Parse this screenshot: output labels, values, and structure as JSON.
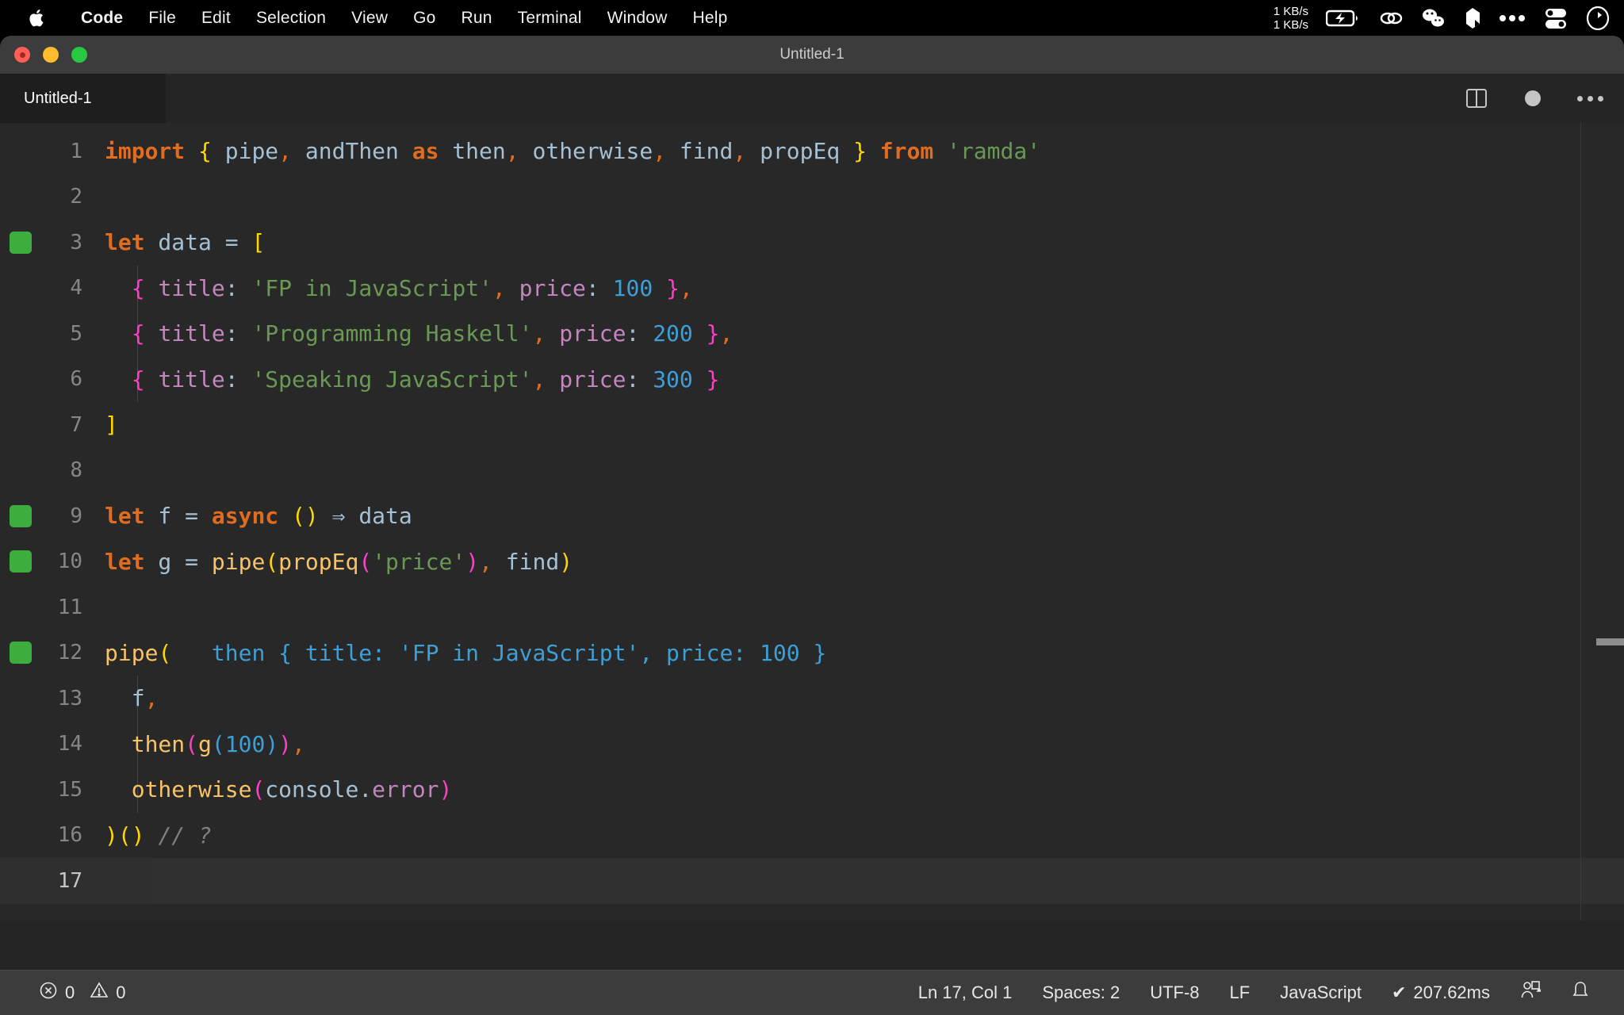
{
  "menubar": {
    "apple_icon": "apple-logo-icon",
    "items": [
      {
        "label": "Code",
        "bold": true
      },
      {
        "label": "File",
        "bold": false
      },
      {
        "label": "Edit",
        "bold": false
      },
      {
        "label": "Selection",
        "bold": false
      },
      {
        "label": "View",
        "bold": false
      },
      {
        "label": "Go",
        "bold": false
      },
      {
        "label": "Run",
        "bold": false
      },
      {
        "label": "Terminal",
        "bold": false
      },
      {
        "label": "Window",
        "bold": false
      },
      {
        "label": "Help",
        "bold": false
      }
    ],
    "network": {
      "up": "1 KB/s",
      "down": "1 KB/s"
    },
    "status_icons": [
      "battery-charging-icon",
      "link-chain-icon",
      "wechat-icon",
      "shape-icon",
      "more-dots-icon",
      "control-center-icon",
      "time-machine-icon"
    ]
  },
  "window": {
    "title": "Untitled-1",
    "traffic_lights": [
      "close-button",
      "minimize-button",
      "maximize-button"
    ]
  },
  "tabs": [
    {
      "label": "Untitled-1",
      "active": true
    }
  ],
  "editor_actions": {
    "split_editor": "split-editor-icon",
    "unsaved_indicator": "unsaved-dot-icon",
    "more_actions": "more-actions-icon"
  },
  "editor": {
    "language": "JavaScript",
    "lines": [
      {
        "n": "1",
        "git": false,
        "indent": false,
        "active": false,
        "tokens": [
          {
            "t": "import",
            "c": "t-kw"
          },
          {
            "t": " ",
            "c": "t-punct"
          },
          {
            "t": "{",
            "c": "b-yellow"
          },
          {
            "t": " pipe",
            "c": "t-var"
          },
          {
            "t": ",",
            "c": "t-comma"
          },
          {
            "t": " andThen ",
            "c": "t-var"
          },
          {
            "t": "as",
            "c": "t-kw"
          },
          {
            "t": " then",
            "c": "t-var"
          },
          {
            "t": ",",
            "c": "t-comma"
          },
          {
            "t": " otherwise",
            "c": "t-var"
          },
          {
            "t": ",",
            "c": "t-comma"
          },
          {
            "t": " find",
            "c": "t-var"
          },
          {
            "t": ",",
            "c": "t-comma"
          },
          {
            "t": " propEq ",
            "c": "t-var"
          },
          {
            "t": "}",
            "c": "b-yellow"
          },
          {
            "t": " ",
            "c": "t-punct"
          },
          {
            "t": "from",
            "c": "t-kw"
          },
          {
            "t": " ",
            "c": "t-punct"
          },
          {
            "t": "'ramda'",
            "c": "t-str"
          }
        ]
      },
      {
        "n": "2",
        "git": false,
        "indent": false,
        "active": false,
        "tokens": []
      },
      {
        "n": "3",
        "git": true,
        "indent": false,
        "active": false,
        "tokens": [
          {
            "t": "let",
            "c": "t-kw"
          },
          {
            "t": " data ",
            "c": "t-var"
          },
          {
            "t": "=",
            "c": "t-op"
          },
          {
            "t": " ",
            "c": "t-punct"
          },
          {
            "t": "[",
            "c": "b-yellow"
          }
        ]
      },
      {
        "n": "4",
        "git": false,
        "indent": true,
        "active": false,
        "tokens": [
          {
            "t": "  ",
            "c": "t-punct"
          },
          {
            "t": "{",
            "c": "b-pink"
          },
          {
            "t": " ",
            "c": "t-punct"
          },
          {
            "t": "title",
            "c": "t-prop"
          },
          {
            "t": ":",
            "c": "t-punct"
          },
          {
            "t": " ",
            "c": "t-punct"
          },
          {
            "t": "'FP in JavaScript'",
            "c": "t-str"
          },
          {
            "t": ",",
            "c": "t-comma"
          },
          {
            "t": " ",
            "c": "t-punct"
          },
          {
            "t": "price",
            "c": "t-prop"
          },
          {
            "t": ":",
            "c": "t-punct"
          },
          {
            "t": " ",
            "c": "t-punct"
          },
          {
            "t": "100",
            "c": "t-num"
          },
          {
            "t": " ",
            "c": "t-punct"
          },
          {
            "t": "}",
            "c": "b-pink"
          },
          {
            "t": ",",
            "c": "t-comma"
          }
        ]
      },
      {
        "n": "5",
        "git": false,
        "indent": true,
        "active": false,
        "tokens": [
          {
            "t": "  ",
            "c": "t-punct"
          },
          {
            "t": "{",
            "c": "b-pink"
          },
          {
            "t": " ",
            "c": "t-punct"
          },
          {
            "t": "title",
            "c": "t-prop"
          },
          {
            "t": ":",
            "c": "t-punct"
          },
          {
            "t": " ",
            "c": "t-punct"
          },
          {
            "t": "'Programming Haskell'",
            "c": "t-str"
          },
          {
            "t": ",",
            "c": "t-comma"
          },
          {
            "t": " ",
            "c": "t-punct"
          },
          {
            "t": "price",
            "c": "t-prop"
          },
          {
            "t": ":",
            "c": "t-punct"
          },
          {
            "t": " ",
            "c": "t-punct"
          },
          {
            "t": "200",
            "c": "t-num"
          },
          {
            "t": " ",
            "c": "t-punct"
          },
          {
            "t": "}",
            "c": "b-pink"
          },
          {
            "t": ",",
            "c": "t-comma"
          }
        ]
      },
      {
        "n": "6",
        "git": false,
        "indent": true,
        "active": false,
        "tokens": [
          {
            "t": "  ",
            "c": "t-punct"
          },
          {
            "t": "{",
            "c": "b-pink"
          },
          {
            "t": " ",
            "c": "t-punct"
          },
          {
            "t": "title",
            "c": "t-prop"
          },
          {
            "t": ":",
            "c": "t-punct"
          },
          {
            "t": " ",
            "c": "t-punct"
          },
          {
            "t": "'Speaking JavaScript'",
            "c": "t-str"
          },
          {
            "t": ",",
            "c": "t-comma"
          },
          {
            "t": " ",
            "c": "t-punct"
          },
          {
            "t": "price",
            "c": "t-prop"
          },
          {
            "t": ":",
            "c": "t-punct"
          },
          {
            "t": " ",
            "c": "t-punct"
          },
          {
            "t": "300",
            "c": "t-num"
          },
          {
            "t": " ",
            "c": "t-punct"
          },
          {
            "t": "}",
            "c": "b-pink"
          }
        ]
      },
      {
        "n": "7",
        "git": false,
        "indent": false,
        "active": false,
        "tokens": [
          {
            "t": "]",
            "c": "b-yellow"
          }
        ]
      },
      {
        "n": "8",
        "git": false,
        "indent": false,
        "active": false,
        "tokens": []
      },
      {
        "n": "9",
        "git": true,
        "indent": false,
        "active": false,
        "tokens": [
          {
            "t": "let",
            "c": "t-kw"
          },
          {
            "t": " f ",
            "c": "t-var"
          },
          {
            "t": "=",
            "c": "t-op"
          },
          {
            "t": " ",
            "c": "t-punct"
          },
          {
            "t": "async",
            "c": "t-kw"
          },
          {
            "t": " ",
            "c": "t-punct"
          },
          {
            "t": "()",
            "c": "b-yellow"
          },
          {
            "t": " ⇒ ",
            "c": "t-op"
          },
          {
            "t": "data",
            "c": "t-var"
          }
        ]
      },
      {
        "n": "10",
        "git": true,
        "indent": false,
        "active": false,
        "tokens": [
          {
            "t": "let",
            "c": "t-kw"
          },
          {
            "t": " g ",
            "c": "t-var"
          },
          {
            "t": "=",
            "c": "t-op"
          },
          {
            "t": " ",
            "c": "t-punct"
          },
          {
            "t": "pipe",
            "c": "t-fn"
          },
          {
            "t": "(",
            "c": "b-yellow"
          },
          {
            "t": "propEq",
            "c": "t-fn"
          },
          {
            "t": "(",
            "c": "b-pink"
          },
          {
            "t": "'price'",
            "c": "t-str"
          },
          {
            "t": ")",
            "c": "b-pink"
          },
          {
            "t": ",",
            "c": "t-comma"
          },
          {
            "t": " find",
            "c": "t-var"
          },
          {
            "t": ")",
            "c": "b-yellow"
          }
        ]
      },
      {
        "n": "11",
        "git": false,
        "indent": false,
        "active": false,
        "tokens": []
      },
      {
        "n": "12",
        "git": true,
        "indent": false,
        "active": false,
        "tokens": [
          {
            "t": "pipe",
            "c": "t-fn"
          },
          {
            "t": "(",
            "c": "b-yellow"
          },
          {
            "t": "   then { title: 'FP in JavaScript', price: 100 }",
            "c": "inline-hint"
          }
        ]
      },
      {
        "n": "13",
        "git": false,
        "indent": true,
        "active": false,
        "tokens": [
          {
            "t": "  f",
            "c": "t-var"
          },
          {
            "t": ",",
            "c": "t-comma"
          }
        ]
      },
      {
        "n": "14",
        "git": false,
        "indent": true,
        "active": false,
        "tokens": [
          {
            "t": "  ",
            "c": "t-punct"
          },
          {
            "t": "then",
            "c": "t-fn"
          },
          {
            "t": "(",
            "c": "b-pink"
          },
          {
            "t": "g",
            "c": "t-fn"
          },
          {
            "t": "(",
            "c": "b-blue"
          },
          {
            "t": "100",
            "c": "t-num"
          },
          {
            "t": ")",
            "c": "b-blue"
          },
          {
            "t": ")",
            "c": "b-pink"
          },
          {
            "t": ",",
            "c": "t-comma"
          }
        ]
      },
      {
        "n": "15",
        "git": false,
        "indent": true,
        "active": false,
        "tokens": [
          {
            "t": "  ",
            "c": "t-punct"
          },
          {
            "t": "otherwise",
            "c": "t-fn"
          },
          {
            "t": "(",
            "c": "b-pink"
          },
          {
            "t": "console",
            "c": "t-var"
          },
          {
            "t": ".",
            "c": "t-punct"
          },
          {
            "t": "error",
            "c": "t-member"
          },
          {
            "t": ")",
            "c": "b-pink"
          }
        ]
      },
      {
        "n": "16",
        "git": false,
        "indent": false,
        "active": false,
        "tokens": [
          {
            "t": ")()",
            "c": "b-yellow"
          },
          {
            "t": " ",
            "c": "t-punct"
          },
          {
            "t": "// ?",
            "c": "t-comment"
          }
        ]
      },
      {
        "n": "17",
        "git": false,
        "indent": false,
        "active": true,
        "tokens": []
      }
    ]
  },
  "statusbar": {
    "errors": "0",
    "warnings": "0",
    "cursor": "Ln 17, Col 1",
    "indentation": "Spaces: 2",
    "encoding": "UTF-8",
    "eol": "LF",
    "language": "JavaScript",
    "runtime": "207.62ms",
    "runtime_check": "✔",
    "icons": [
      "error-icon",
      "warning-icon",
      "remote-account-icon",
      "bell-icon"
    ]
  }
}
